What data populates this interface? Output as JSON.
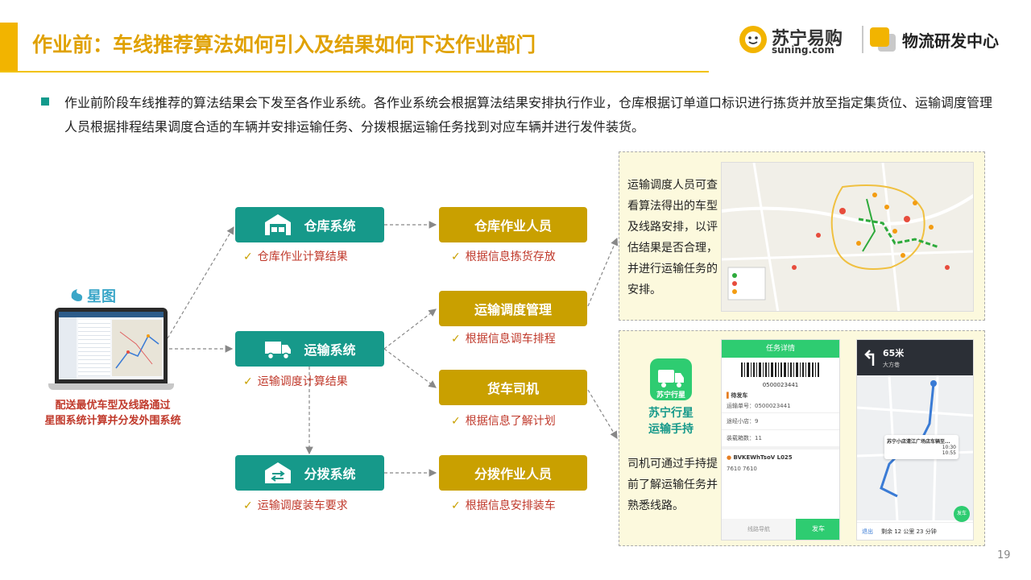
{
  "header": {
    "title": "作业前：车线推荐算法如何引入及结果如何下达作业部门",
    "brand_cn": "苏宁易购",
    "brand_en": "suning.com",
    "lab_name": "物流研发中心"
  },
  "intro": "作业前阶段车线推荐的算法结果会下发至各作业系统。各作业系统会根据算法结果安排执行作业，仓库根据订单道口标识进行拣货并放至指定集货位、运输调度管理人员根据排程结果调度合适的车辆并安排运输任务、分拨根据运输任务找到对应车辆并进行发件装货。",
  "source": {
    "logo_text": "星图",
    "caption_line1": "配送最优车型及线路通过",
    "caption_line2": "星图系统计算并分发外围系统"
  },
  "systems": [
    {
      "name": "仓库系统",
      "note": "仓库作业计算结果",
      "icon": "warehouse-icon"
    },
    {
      "name": "运输系统",
      "note": "运输调度计算结果",
      "icon": "truck-icon"
    },
    {
      "name": "分拨系统",
      "note": "运输调度装车要求",
      "icon": "sorting-icon"
    }
  ],
  "roles": [
    {
      "name": "仓库作业人员",
      "note": "根据信息拣货存放"
    },
    {
      "name": "运输调度管理",
      "note": "根据信息调车排程"
    },
    {
      "name": "货车司机",
      "note": "根据信息了解计划"
    },
    {
      "name": "分拨作业人员",
      "note": "根据信息安排装车"
    }
  ],
  "panel_top": {
    "text": "运输调度人员可查看算法得出的车型及线路安排，以评估结果是否合理，并进行运输任务的安排。"
  },
  "panel_bottom": {
    "app_name_line1": "苏宁行星",
    "app_name_line2": "运输手持",
    "app_badge": "苏宁行星",
    "text": "司机可通过手持提前了解运输任务并熟悉线路。",
    "phone1": {
      "title": "任务详情",
      "barcode": "0500023441",
      "status": "待发车",
      "task_label": "运输单号：0500023441",
      "stores": "途经小店：9",
      "boxes": "装载箱数：11",
      "vehicle": "BVKEWhTsoV L025",
      "route": "7610 7610",
      "btn_nav": "线路导航",
      "btn_go": "发车"
    },
    "phone2": {
      "dist": "65米",
      "road": "大方巷",
      "card_title": "苏宁小店清江广场店车辆至...",
      "t1": "10:30",
      "t2": "10:55",
      "remain": "剩余 12 公里  23 分钟",
      "exit": "退出",
      "go": "发车"
    }
  },
  "page_number": "19",
  "colors": {
    "teal": "#16998a",
    "gold": "#c9a000",
    "accent": "#f2b400",
    "red": "#c0392b"
  }
}
